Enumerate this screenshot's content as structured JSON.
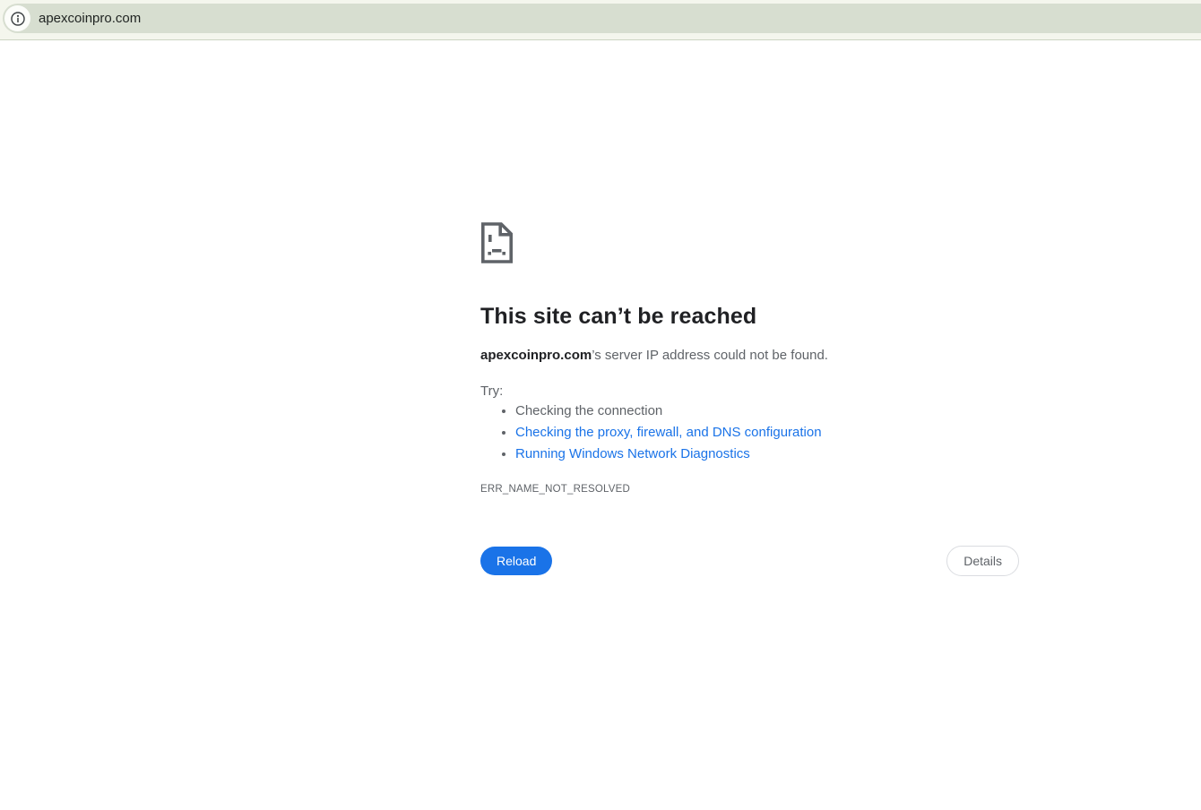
{
  "browser": {
    "url": "apexcoinpro.com",
    "info_icon": "page-info-icon"
  },
  "error_page": {
    "title": "This site can’t be reached",
    "domain": "apexcoinpro.com",
    "description_rest": "’s server IP address could not be found.",
    "try_label": "Try:",
    "suggestions": [
      {
        "label": "Checking the connection",
        "is_link": false
      },
      {
        "label": "Checking the proxy, firewall, and DNS configuration",
        "is_link": true
      },
      {
        "label": "Running Windows Network Diagnostics",
        "is_link": true
      }
    ],
    "error_code": "ERR_NAME_NOT_RESOLVED",
    "reload_label": "Reload",
    "details_label": "Details"
  },
  "colors": {
    "toolbar_background": "#f4f6ed",
    "addressbar_background": "#d7ded0",
    "toolbar_border": "#ccd4c3",
    "link_blue": "#1a73e8",
    "reload_button_blue": "#1a73e8",
    "text_dark": "#202124",
    "text_gray": "#5f6368",
    "details_border": "#dadce0",
    "icon_gray": "#5f6368"
  }
}
